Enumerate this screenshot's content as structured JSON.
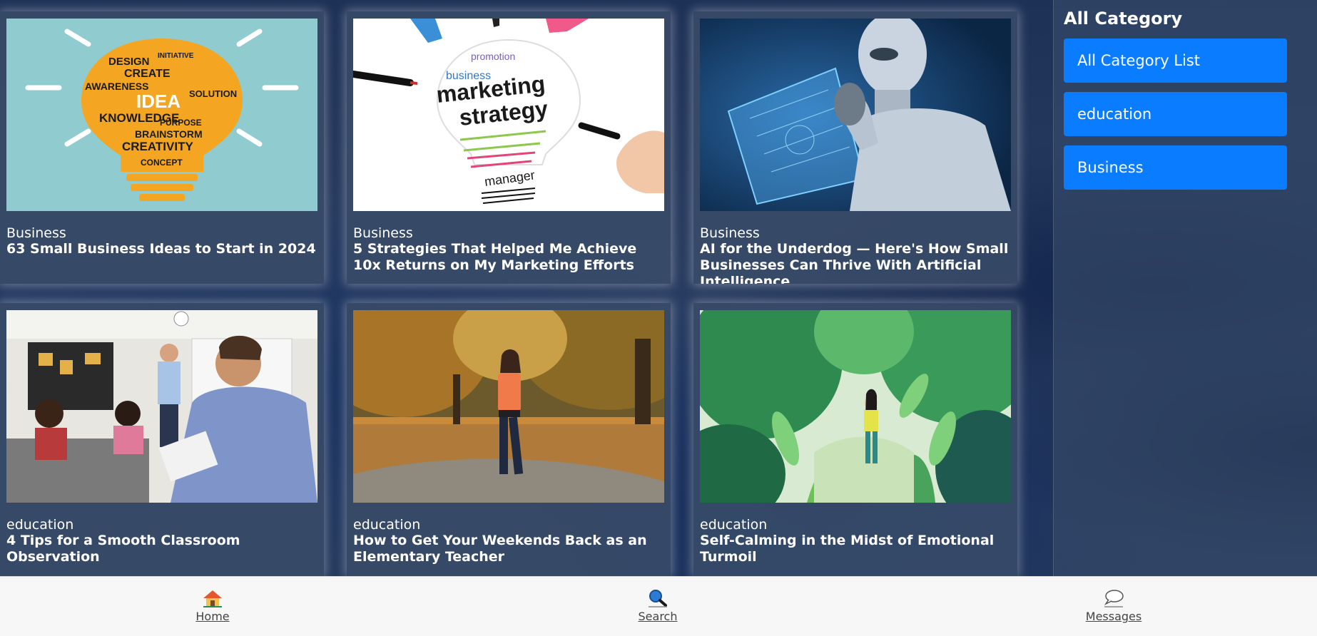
{
  "posts": [
    {
      "category": "Business",
      "title": "63 Small Business Ideas to Start in 2024",
      "image": "idea-lightbulb-wordcloud"
    },
    {
      "category": "Business",
      "title": "5 Strategies That Helped Me Achieve 10x Returns on My Marketing Efforts",
      "image": "marketing-strategy-drawing"
    },
    {
      "category": "Business",
      "title": "AI for the Underdog — Here's How Small Businesses Can Thrive With Artificial Intelligence",
      "image": "robot-hologram"
    },
    {
      "category": "education",
      "title": "4 Tips for a Smooth Classroom Observation",
      "image": "classroom-observation"
    },
    {
      "category": "education",
      "title": "How to Get Your Weekends Back as an Elementary Teacher",
      "image": "woman-walking-autumn-park"
    },
    {
      "category": "education",
      "title": "Self-Calming in the Midst of Emotional Turmoil",
      "image": "person-in-jungle-illustration"
    }
  ],
  "idea_words": [
    "DESIGN",
    "INITIATIVE",
    "CREATE",
    "AWARENESS",
    "IDEA",
    "SOLUTION",
    "KNOWLEDGE",
    "PURPOSE",
    "BRAINSTORM",
    "CREATIVITY",
    "CONCEPT"
  ],
  "marketing_words": [
    "marketing",
    "strategy",
    "business",
    "promotion",
    "manager"
  ],
  "sidebar": {
    "title": "All Category",
    "items": [
      {
        "label": "All Category List"
      },
      {
        "label": "education"
      },
      {
        "label": "Business"
      }
    ]
  },
  "bottom_nav": {
    "items": [
      {
        "label": "Home",
        "icon": "home-icon"
      },
      {
        "label": "Search",
        "icon": "search-icon"
      },
      {
        "label": "Messages",
        "icon": "speech-bubble-icon"
      }
    ]
  },
  "colors": {
    "accent": "#0a7cff",
    "card_text": "#ffffff",
    "bottom_bar": "#f7f7f7"
  }
}
